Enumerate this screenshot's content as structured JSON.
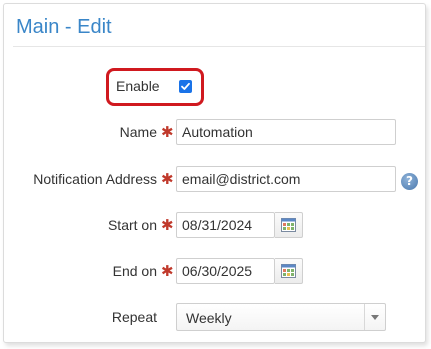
{
  "header": {
    "title": "Main - Edit"
  },
  "form": {
    "enable": {
      "label": "Enable",
      "checked": true
    },
    "name": {
      "label": "Name",
      "value": "Automation"
    },
    "notification": {
      "label": "Notification Address",
      "value": "email@district.com",
      "help_icon": "question-circle-icon"
    },
    "start_on": {
      "label": "Start on",
      "value": "08/31/2024",
      "icon": "calendar-icon"
    },
    "end_on": {
      "label": "End on",
      "value": "06/30/2025",
      "icon": "calendar-icon"
    },
    "repeat": {
      "label": "Repeat",
      "selected": "Weekly"
    },
    "required_marker": "✱"
  },
  "colors": {
    "title": "#3a86c8",
    "highlight_border": "#d0191f",
    "required": "#c0392b",
    "checkbox": "#1a73e8"
  }
}
